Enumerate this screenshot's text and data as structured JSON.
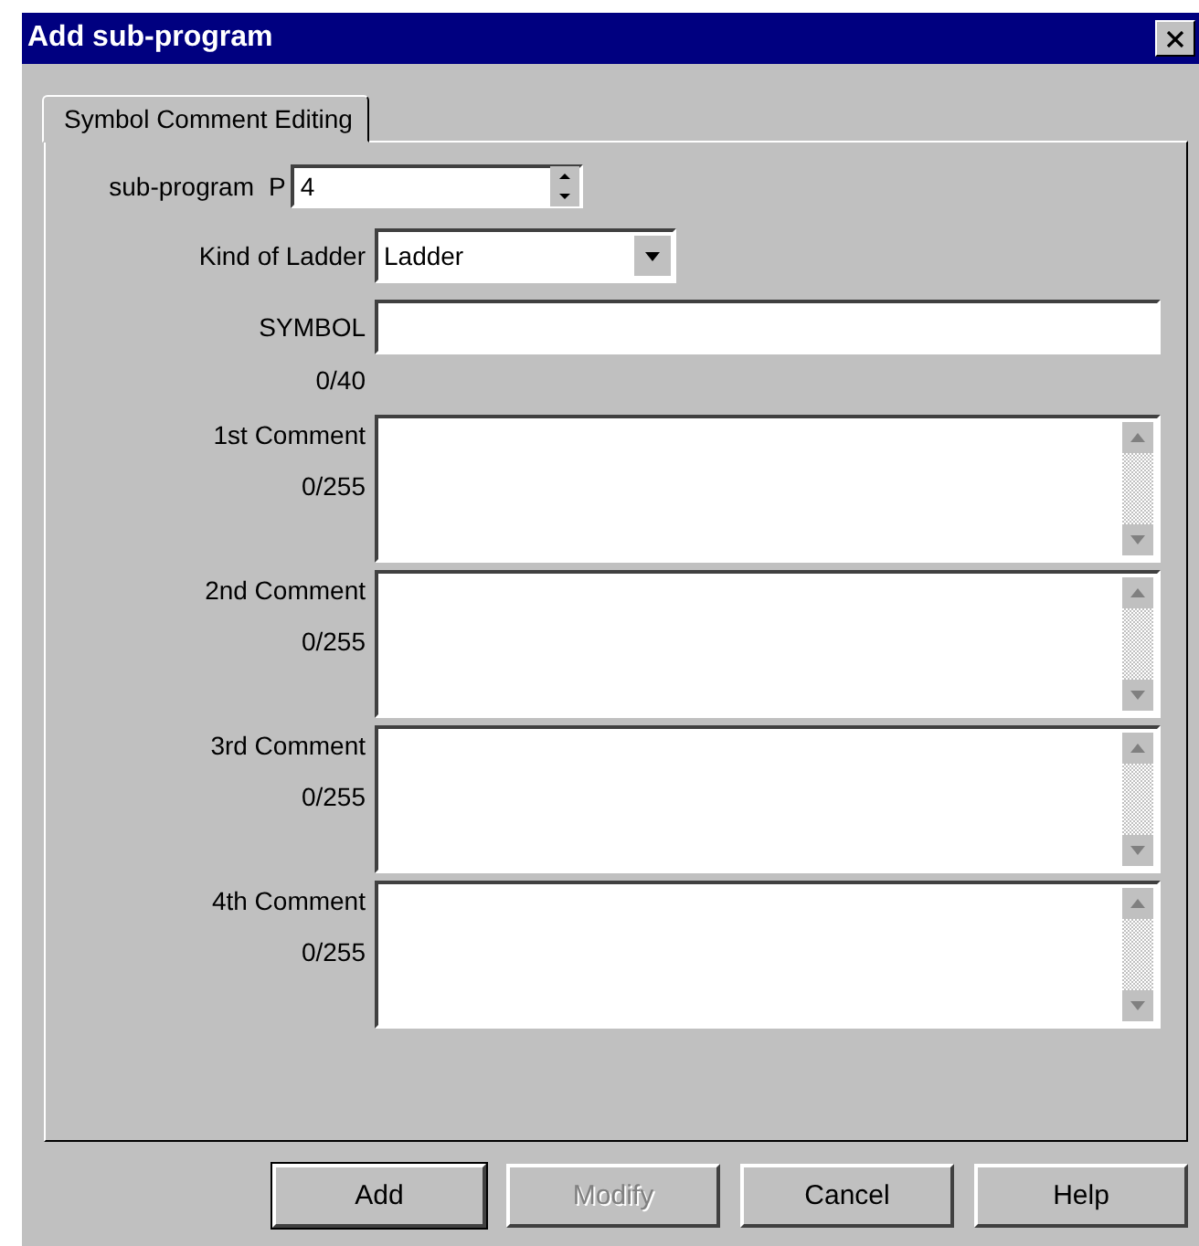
{
  "window": {
    "title": "Add sub-program"
  },
  "tabs": [
    {
      "label": "Symbol Comment Editing",
      "selected": true
    }
  ],
  "sub_program": {
    "label": "sub-program",
    "prefix": "P",
    "value": "4"
  },
  "kind_of_ladder": {
    "label": "Kind of Ladder",
    "value": "Ladder"
  },
  "symbol": {
    "label": "SYMBOL",
    "count": "0/40"
  },
  "comments": [
    {
      "label": "1st Comment",
      "count": "0/255"
    },
    {
      "label": "2nd Comment",
      "count": "0/255"
    },
    {
      "label": "3rd Comment",
      "count": "0/255"
    },
    {
      "label": "4th Comment",
      "count": "0/255"
    }
  ],
  "buttons": [
    {
      "label": "Add",
      "disabled": false,
      "default": true
    },
    {
      "label": "Modify",
      "disabled": true,
      "default": false
    },
    {
      "label": "Cancel",
      "disabled": false,
      "default": false
    },
    {
      "label": "Help",
      "disabled": false,
      "default": false
    }
  ]
}
